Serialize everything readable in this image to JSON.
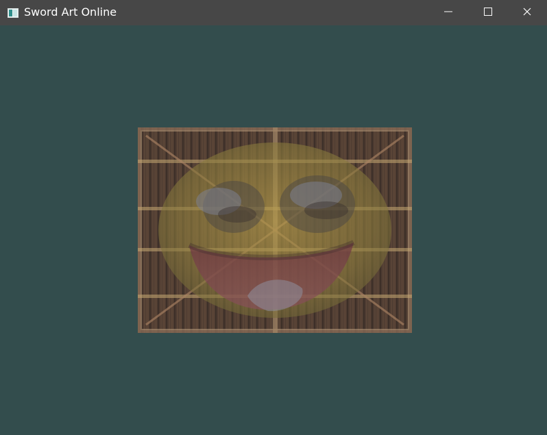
{
  "window": {
    "title": "Sword Art Online",
    "icon": "app-window-icon",
    "controls": {
      "minimize_icon": "minimize-icon",
      "maximize_icon": "maximize-icon",
      "close_icon": "close-icon"
    }
  },
  "scene": {
    "background_color": "#334d4d",
    "rendered_object": "textured-quad",
    "textures": [
      "wooden-container-texture",
      "awesome-face-texture"
    ]
  }
}
